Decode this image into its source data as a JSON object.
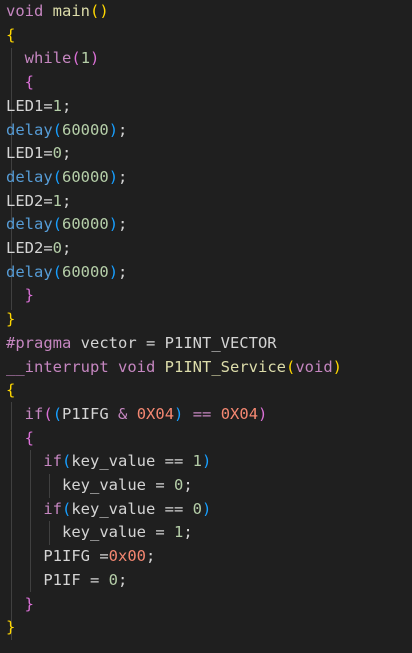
{
  "code": {
    "lines": [
      {
        "segments": [
          {
            "t": "void",
            "c": "kw"
          },
          {
            "t": " ",
            "c": "plain"
          },
          {
            "t": "main",
            "c": "fn"
          },
          {
            "t": "()",
            "c": "bracket1"
          }
        ]
      },
      {
        "segments": [
          {
            "t": "{",
            "c": "bracket1"
          }
        ]
      },
      {
        "segments": [
          {
            "t": "  ",
            "c": "plain"
          },
          {
            "t": "while",
            "c": "kw"
          },
          {
            "t": "(",
            "c": "bracket2"
          },
          {
            "t": "1",
            "c": "num"
          },
          {
            "t": ")",
            "c": "bracket2"
          }
        ]
      },
      {
        "segments": [
          {
            "t": "  ",
            "c": "plain"
          },
          {
            "t": "{",
            "c": "bracket2"
          }
        ]
      },
      {
        "segments": [
          {
            "t": "LED1",
            "c": "ident"
          },
          {
            "t": "=",
            "c": "op"
          },
          {
            "t": "1",
            "c": "num"
          },
          {
            "t": ";",
            "c": "plain"
          }
        ]
      },
      {
        "segments": [
          {
            "t": "delay",
            "c": "hlfn"
          },
          {
            "t": "(",
            "c": "bracket3"
          },
          {
            "t": "60000",
            "c": "num"
          },
          {
            "t": ")",
            "c": "bracket3"
          },
          {
            "t": ";",
            "c": "plain"
          }
        ]
      },
      {
        "segments": [
          {
            "t": "LED1",
            "c": "ident"
          },
          {
            "t": "=",
            "c": "op"
          },
          {
            "t": "0",
            "c": "num"
          },
          {
            "t": ";",
            "c": "plain"
          }
        ]
      },
      {
        "segments": [
          {
            "t": "delay",
            "c": "hlfn"
          },
          {
            "t": "(",
            "c": "bracket3"
          },
          {
            "t": "60000",
            "c": "num"
          },
          {
            "t": ")",
            "c": "bracket3"
          },
          {
            "t": ";",
            "c": "plain"
          }
        ]
      },
      {
        "segments": [
          {
            "t": "LED2",
            "c": "ident"
          },
          {
            "t": "=",
            "c": "op"
          },
          {
            "t": "1",
            "c": "num"
          },
          {
            "t": ";",
            "c": "plain"
          }
        ]
      },
      {
        "segments": [
          {
            "t": "delay",
            "c": "hlfn"
          },
          {
            "t": "(",
            "c": "bracket3"
          },
          {
            "t": "60000",
            "c": "num"
          },
          {
            "t": ")",
            "c": "bracket3"
          },
          {
            "t": ";",
            "c": "plain"
          }
        ]
      },
      {
        "segments": [
          {
            "t": "LED2",
            "c": "ident"
          },
          {
            "t": "=",
            "c": "op"
          },
          {
            "t": "0",
            "c": "num"
          },
          {
            "t": ";",
            "c": "plain"
          }
        ]
      },
      {
        "segments": [
          {
            "t": "delay",
            "c": "hlfn"
          },
          {
            "t": "(",
            "c": "bracket3"
          },
          {
            "t": "60000",
            "c": "num"
          },
          {
            "t": ")",
            "c": "bracket3"
          },
          {
            "t": ";",
            "c": "plain"
          }
        ]
      },
      {
        "segments": [
          {
            "t": "  ",
            "c": "plain"
          },
          {
            "t": "}",
            "c": "bracket2"
          }
        ]
      },
      {
        "segments": [
          {
            "t": "}",
            "c": "bracket1"
          }
        ]
      },
      {
        "segments": [
          {
            "t": "#pragma",
            "c": "pre"
          },
          {
            "t": " vector = ",
            "c": "plain"
          },
          {
            "t": "P1INT_VECTOR",
            "c": "ident"
          }
        ]
      },
      {
        "segments": [
          {
            "t": "__interrupt",
            "c": "kw"
          },
          {
            "t": " ",
            "c": "plain"
          },
          {
            "t": "void",
            "c": "kw"
          },
          {
            "t": " ",
            "c": "plain"
          },
          {
            "t": "P1INT_Service",
            "c": "fn"
          },
          {
            "t": "(",
            "c": "bracket1"
          },
          {
            "t": "void",
            "c": "kw"
          },
          {
            "t": ")",
            "c": "bracket1"
          }
        ]
      },
      {
        "segments": [
          {
            "t": "{",
            "c": "bracket1"
          }
        ]
      },
      {
        "segments": [
          {
            "t": "  ",
            "c": "plain"
          },
          {
            "t": "if",
            "c": "kw"
          },
          {
            "t": "(",
            "c": "bracket2"
          },
          {
            "t": "(",
            "c": "bracket3"
          },
          {
            "t": "P1IFG",
            "c": "ident"
          },
          {
            "t": " & ",
            "c": "kw"
          },
          {
            "t": "0X04",
            "c": "numred"
          },
          {
            "t": ")",
            "c": "bracket3"
          },
          {
            "t": " == ",
            "c": "kw"
          },
          {
            "t": "0X04",
            "c": "numred"
          },
          {
            "t": ")",
            "c": "bracket2"
          }
        ]
      },
      {
        "segments": [
          {
            "t": "  ",
            "c": "plain"
          },
          {
            "t": "{",
            "c": "bracket2"
          }
        ]
      },
      {
        "segments": [
          {
            "t": "    ",
            "c": "plain"
          },
          {
            "t": "if",
            "c": "kw"
          },
          {
            "t": "(",
            "c": "bracket3"
          },
          {
            "t": "key_value",
            "c": "ident"
          },
          {
            "t": " == ",
            "c": "op"
          },
          {
            "t": "1",
            "c": "num"
          },
          {
            "t": ")",
            "c": "bracket3"
          }
        ]
      },
      {
        "segments": [
          {
            "t": "      ",
            "c": "plain"
          },
          {
            "t": "key_value",
            "c": "ident"
          },
          {
            "t": " = ",
            "c": "op"
          },
          {
            "t": "0",
            "c": "num"
          },
          {
            "t": ";",
            "c": "plain"
          }
        ]
      },
      {
        "segments": [
          {
            "t": "    ",
            "c": "plain"
          },
          {
            "t": "if",
            "c": "kw"
          },
          {
            "t": "(",
            "c": "bracket3"
          },
          {
            "t": "key_value",
            "c": "ident"
          },
          {
            "t": " == ",
            "c": "op"
          },
          {
            "t": "0",
            "c": "num"
          },
          {
            "t": ")",
            "c": "bracket3"
          }
        ]
      },
      {
        "segments": [
          {
            "t": "      ",
            "c": "plain"
          },
          {
            "t": "key_value",
            "c": "ident"
          },
          {
            "t": " = ",
            "c": "op"
          },
          {
            "t": "1",
            "c": "num"
          },
          {
            "t": ";",
            "c": "plain"
          }
        ]
      },
      {
        "segments": [
          {
            "t": "    ",
            "c": "plain"
          },
          {
            "t": "P1IFG",
            "c": "ident"
          },
          {
            "t": " =",
            "c": "op"
          },
          {
            "t": "0x00",
            "c": "numred"
          },
          {
            "t": ";",
            "c": "plain"
          }
        ]
      },
      {
        "segments": [
          {
            "t": "    ",
            "c": "plain"
          },
          {
            "t": "P1IF",
            "c": "ident"
          },
          {
            "t": " = ",
            "c": "op"
          },
          {
            "t": "0",
            "c": "num"
          },
          {
            "t": ";",
            "c": "plain"
          }
        ]
      },
      {
        "segments": [
          {
            "t": "  ",
            "c": "plain"
          },
          {
            "t": "}",
            "c": "bracket2"
          }
        ]
      },
      {
        "segments": [
          {
            "t": "}",
            "c": "bracket1"
          }
        ]
      }
    ]
  }
}
